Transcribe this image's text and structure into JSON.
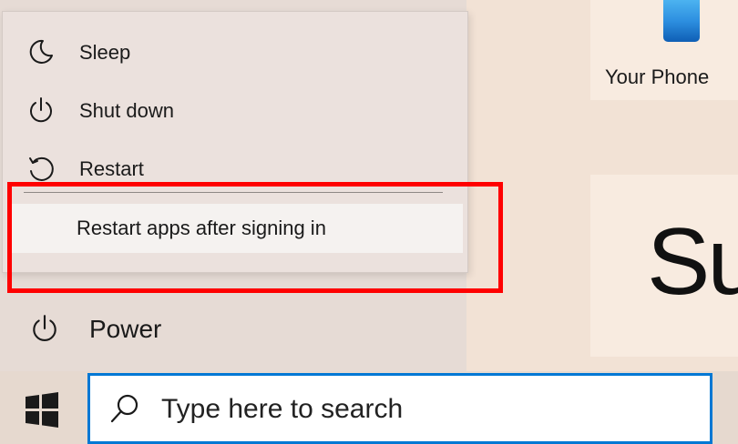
{
  "power_menu": {
    "items": [
      {
        "label": "Sleep",
        "icon": "moon-icon"
      },
      {
        "label": "Shut down",
        "icon": "power-icon"
      },
      {
        "label": "Restart",
        "icon": "restart-icon"
      }
    ],
    "sub_option": {
      "label": "Restart apps after signing in"
    }
  },
  "start_menu": {
    "power": {
      "label": "Power",
      "icon": "power-icon"
    }
  },
  "tiles": {
    "your_phone": {
      "label": "Your Phone",
      "icon": "phone-icon"
    },
    "partial_tile": {
      "text": "Su"
    }
  },
  "taskbar": {
    "start_icon": "windows-logo-icon",
    "search": {
      "placeholder": "Type here to search",
      "icon": "search-icon"
    }
  },
  "colors": {
    "highlight_border": "#ff0000",
    "search_border": "#0078d4"
  }
}
